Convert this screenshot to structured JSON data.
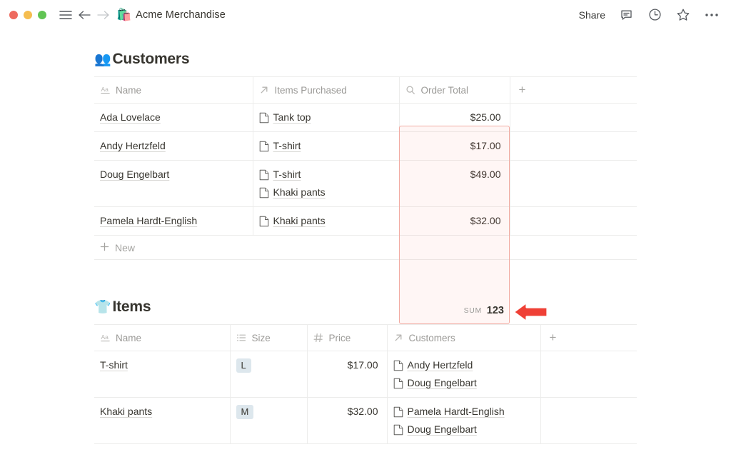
{
  "titlebar": {
    "traffic_lights": [
      "close",
      "minimize",
      "maximize"
    ],
    "menu_icon": "hamburger-icon",
    "back_icon": "arrow-left-icon",
    "forward_icon": "arrow-right-icon",
    "doc_emoji": "🛍️",
    "doc_title": "Acme Merchandise",
    "share_label": "Share",
    "comment_icon": "comment-icon",
    "history_icon": "clock-icon",
    "favorite_icon": "star-icon",
    "more_icon": "ellipsis-icon"
  },
  "customers": {
    "emoji": "👥",
    "title": "Customers",
    "columns": [
      {
        "label": "Name",
        "icon": "text-type-icon"
      },
      {
        "label": "Items Purchased",
        "icon": "relation-arrow-icon"
      },
      {
        "label": "Order Total",
        "icon": "rollup-search-icon"
      }
    ],
    "add_column_label": "+",
    "rows": [
      {
        "name": "Ada Lovelace",
        "items": [
          "Tank top"
        ],
        "total": "$25.00"
      },
      {
        "name": "Andy Hertzfeld",
        "items": [
          "T-shirt"
        ],
        "total": "$17.00"
      },
      {
        "name": "Doug Engelbart",
        "items": [
          "T-shirt",
          "Khaki pants"
        ],
        "total": "$49.00"
      },
      {
        "name": "Pamela Hardt-English",
        "items": [
          "Khaki pants"
        ],
        "total": "$32.00"
      }
    ],
    "new_row_label": "New",
    "footer": {
      "aggregation": "SUM",
      "value": "123"
    }
  },
  "items": {
    "emoji": "👕",
    "title": "Items",
    "columns": [
      {
        "label": "Name",
        "icon": "text-type-icon"
      },
      {
        "label": "Size",
        "icon": "select-list-icon"
      },
      {
        "label": "Price",
        "icon": "number-hash-icon"
      },
      {
        "label": "Customers",
        "icon": "relation-arrow-icon"
      }
    ],
    "add_column_label": "+",
    "rows": [
      {
        "name": "T-shirt",
        "size": "L",
        "price": "$17.00",
        "customers": [
          "Andy Hertzfeld",
          "Doug Engelbart"
        ]
      },
      {
        "name": "Khaki pants",
        "size": "M",
        "price": "$32.00",
        "customers": [
          "Pamela Hardt-English",
          "Doug Engelbart"
        ]
      }
    ]
  },
  "annotation": {
    "arrow_icon": "pointer-arrow-left-icon",
    "arrow_color": "#ef4036",
    "highlight_border_color": "#f2aba2",
    "highlight_fill_color": "#fdf1ee"
  }
}
